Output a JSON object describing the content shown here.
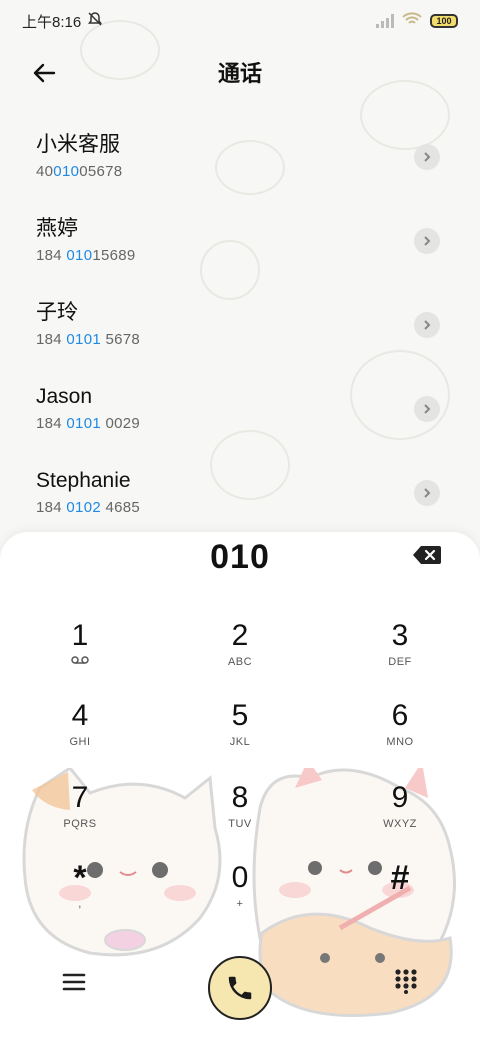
{
  "status_bar": {
    "time": "上午8:16",
    "battery": "100"
  },
  "header": {
    "title": "通话"
  },
  "contacts": [
    {
      "name": "小米客服",
      "num_pre": "40",
      "num_hl": "010",
      "num_post": "05678"
    },
    {
      "name": "燕婷",
      "num_pre": "184 ",
      "num_hl": "010",
      "num_post": "15689"
    },
    {
      "name": "子玲",
      "num_pre": "184 ",
      "num_hl": "0101",
      "num_post": " 5678"
    },
    {
      "name": "Jason",
      "num_pre": "184 ",
      "num_hl": "0101",
      "num_post": " 0029"
    },
    {
      "name": "Stephanie",
      "num_pre": "184 ",
      "num_hl": "0102",
      "num_post": " 4685"
    }
  ],
  "dialpad": {
    "input": "010",
    "keys": [
      {
        "digit": "1",
        "letters": ""
      },
      {
        "digit": "2",
        "letters": "ABC"
      },
      {
        "digit": "3",
        "letters": "DEF"
      },
      {
        "digit": "4",
        "letters": "GHI"
      },
      {
        "digit": "5",
        "letters": "JKL"
      },
      {
        "digit": "6",
        "letters": "MNO"
      },
      {
        "digit": "7",
        "letters": "PQRS"
      },
      {
        "digit": "8",
        "letters": "TUV"
      },
      {
        "digit": "9",
        "letters": "WXYZ"
      },
      {
        "digit": "*",
        "letters": ","
      },
      {
        "digit": "0",
        "letters": "+"
      },
      {
        "digit": "#",
        "letters": ""
      }
    ]
  },
  "colors": {
    "highlight": "#1e8ae6",
    "call_button": "#f6e6b0"
  },
  "icons": {
    "back": "arrow-left-icon",
    "detail": "chevron-right-icon",
    "backspace": "backspace-icon",
    "menu": "menu-icon",
    "call": "phone-icon",
    "keypad": "dialpad-icon",
    "voicemail": "voicemail-icon"
  }
}
